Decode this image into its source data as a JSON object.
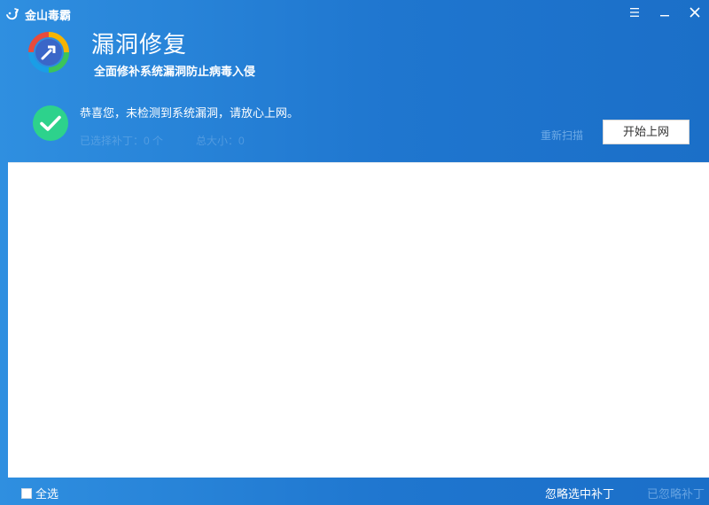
{
  "window": {
    "app_name": "金山毒霸",
    "brand_icon": "kingsoft-logo-icon",
    "controls": [
      "menu-icon",
      "minimize-icon",
      "close-icon"
    ]
  },
  "header": {
    "icon": "vulnerability-repair-icon",
    "title": "漏洞修复",
    "subtitle": "全面修补系统漏洞防止病毒入侵"
  },
  "status": {
    "icon": "success-check-icon",
    "message": "恭喜您，未检测到系统漏洞，请放心上网。",
    "selected_patches": "已选择补丁：0 个",
    "total_size": "总大小：0",
    "rescan_label": "重新扫描",
    "start_button_label": "开始上网"
  },
  "footer": {
    "select_all_label": "全选",
    "ignore_selected_label": "忽略选中补丁",
    "ignored_patches_label": "已忽略补丁"
  },
  "colors": {
    "background_start": "#2f8fe0",
    "background_end": "#1b6fc8",
    "success_green": "#2dd28c",
    "panel": "#ffffff"
  }
}
